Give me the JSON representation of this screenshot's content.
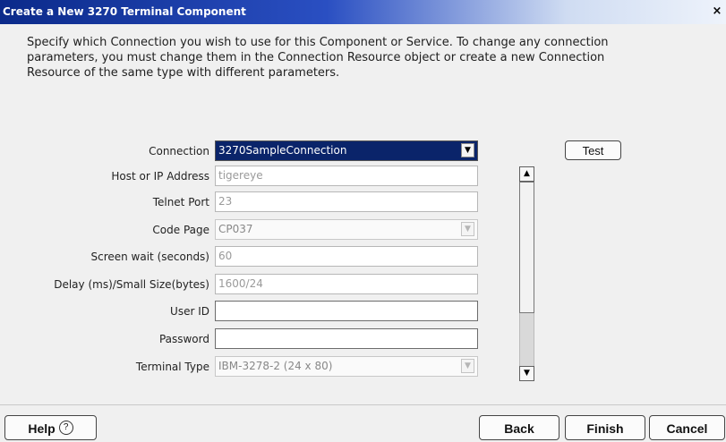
{
  "window": {
    "title": "Create a New 3270 Terminal Component",
    "close_glyph": "×"
  },
  "description": [
    "Specify which Connection you wish to use for this Component or Service.  To change any connection",
    "parameters, you must change them in the Connection Resource object or create a new Connection",
    "Resource of the same type with different parameters."
  ],
  "form": {
    "connection": {
      "label": "Connection",
      "value": "3270SampleConnection"
    },
    "host": {
      "label": "Host or IP Address",
      "value": "tigereye"
    },
    "telnet_port": {
      "label": "Telnet Port",
      "value": "23"
    },
    "code_page": {
      "label": "Code Page",
      "value": "CP037"
    },
    "screen_wait": {
      "label": "Screen wait (seconds)",
      "value": "60"
    },
    "delay": {
      "label": "Delay (ms)/Small Size(bytes)",
      "value": "1600/24"
    },
    "user_id": {
      "label": "User ID",
      "value": ""
    },
    "password": {
      "label": "Password",
      "value": ""
    },
    "terminal_type": {
      "label": "Terminal Type",
      "value": "IBM-3278-2 (24 x 80)"
    }
  },
  "buttons": {
    "test": "Test",
    "help": "Help",
    "help_icon": "?",
    "back": "Back",
    "finish": "Finish",
    "cancel": "Cancel"
  },
  "icons": {
    "dropdown": "chevron-down-icon",
    "scroll_up": "chevron-up-icon",
    "scroll_down": "chevron-down-icon",
    "help": "question-circle-icon"
  },
  "colors": {
    "title_bar": "#0b2a8a",
    "selected_field": "#0a246a"
  }
}
